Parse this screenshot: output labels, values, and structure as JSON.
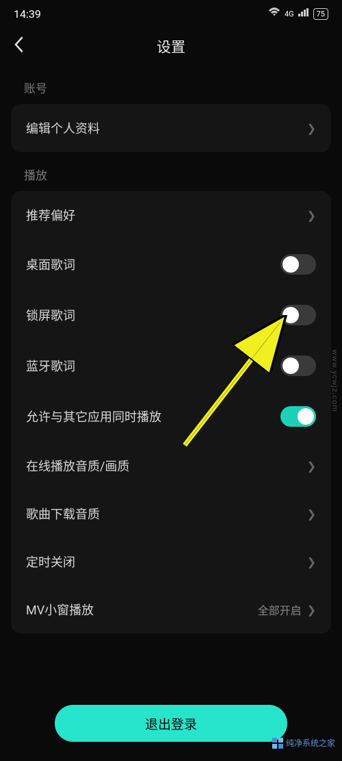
{
  "statusBar": {
    "time": "14:39",
    "network": "4G",
    "battery": "75"
  },
  "header": {
    "title": "设置"
  },
  "sections": {
    "account": {
      "header": "账号",
      "editProfile": "编辑个人资料"
    },
    "playback": {
      "header": "播放",
      "preference": "推荐偏好",
      "desktopLyrics": "桌面歌词",
      "lockscreenLyrics": "锁屏歌词",
      "bluetoothLyrics": "蓝牙歌词",
      "allowSimultaneous": "允许与其它应用同时播放",
      "onlineQuality": "在线播放音质/画质",
      "downloadQuality": "歌曲下载音质",
      "timerOff": "定时关闭",
      "mvWindow": "MV小窗播放",
      "mvWindowValue": "全部开启"
    }
  },
  "toggles": {
    "desktopLyrics": false,
    "lockscreenLyrics": false,
    "bluetoothLyrics": false,
    "allowSimultaneous": true
  },
  "logout": "退出登录",
  "watermark": {
    "text": "纯净系统之家",
    "url": "www.ycwjz.com"
  }
}
